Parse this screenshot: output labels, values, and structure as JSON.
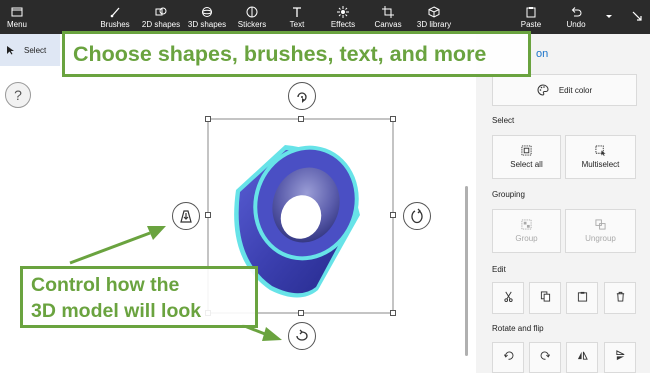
{
  "toolbar": {
    "menu_label": "Menu",
    "items": [
      {
        "label": "Brushes",
        "icon": "brush-icon"
      },
      {
        "label": "2D shapes",
        "icon": "2d-shapes-icon"
      },
      {
        "label": "3D shapes",
        "icon": "3d-shapes-icon"
      },
      {
        "label": "Stickers",
        "icon": "stickers-icon"
      },
      {
        "label": "Text",
        "icon": "text-icon"
      },
      {
        "label": "Effects",
        "icon": "effects-icon"
      },
      {
        "label": "Canvas",
        "icon": "canvas-icon"
      },
      {
        "label": "3D library",
        "icon": "3d-library-icon"
      }
    ],
    "paste_label": "Paste",
    "undo_label": "Undo"
  },
  "canvas": {
    "select_label": "Select",
    "help_label": "?"
  },
  "panel": {
    "title_fragment": "on",
    "edit_color_label": "Edit color",
    "select_section": "Select",
    "select_all_label": "Select all",
    "multiselect_label": "Multiselect",
    "grouping_section": "Grouping",
    "group_label": "Group",
    "ungroup_label": "Ungroup",
    "edit_section": "Edit",
    "rotate_section": "Rotate and flip"
  },
  "callouts": {
    "top": "Choose shapes, brushes, text, and more",
    "bottom_line1": "Control how the",
    "bottom_line2": "3D model will look"
  },
  "colors": {
    "toolbar_bg": "#2b2b2b",
    "callout_green": "#6aa33f",
    "accent_blue": "#1a73c9",
    "model_blue": "#4a4fc4",
    "model_glow": "#67e3e8"
  }
}
